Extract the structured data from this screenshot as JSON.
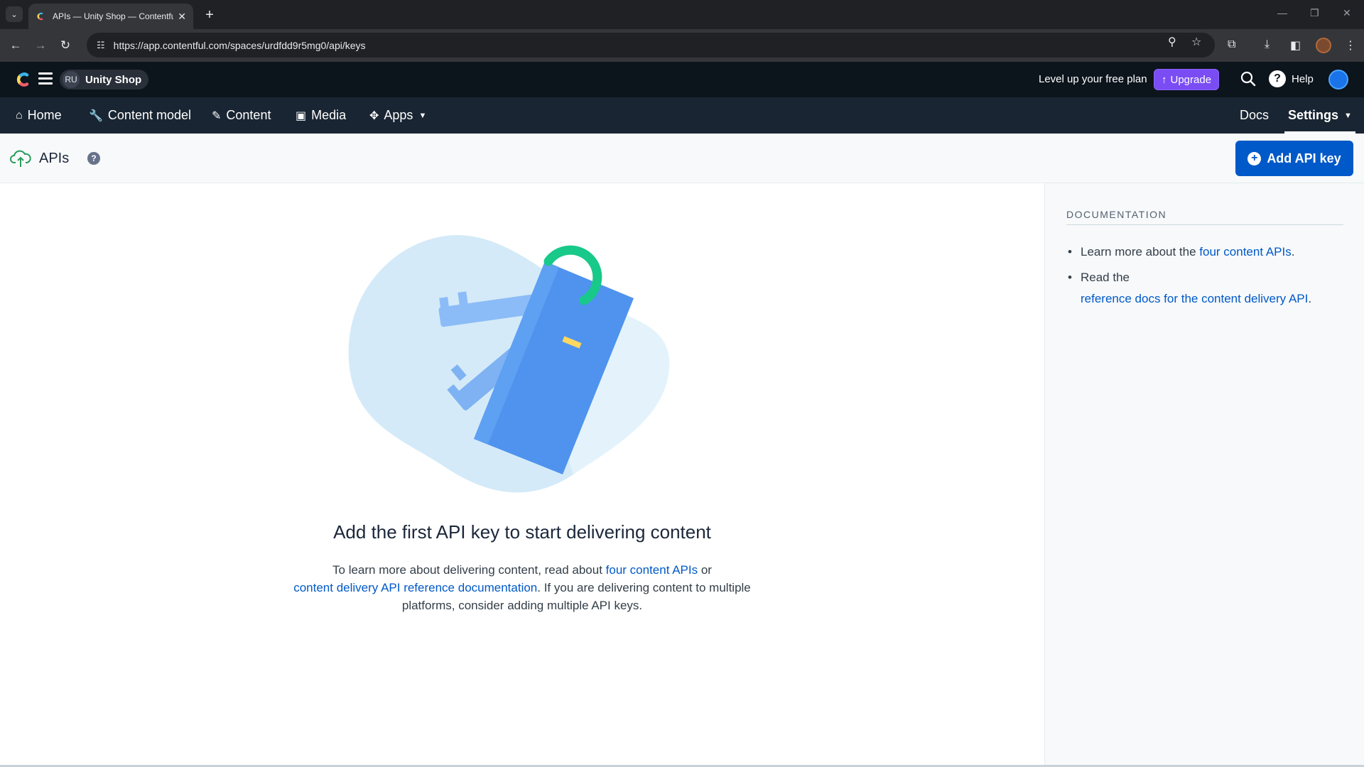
{
  "browser": {
    "tab_title": "APIs — Unity Shop — Contentful",
    "tab_close": "✕",
    "new_tab": "+",
    "url": "https://app.contentful.com/spaces/urdfdd9r5mg0/api/keys"
  },
  "app": {
    "space_initials": "RU",
    "space_name": "Unity Shop",
    "level_up": "Level up your free plan",
    "upgrade_label": "Upgrade",
    "help_label": "Help",
    "brand_color": "#0059c8",
    "upgrade_color": "#7a4cf4"
  },
  "nav": {
    "home": "Home",
    "content_model": "Content model",
    "content": "Content",
    "media": "Media",
    "apps": "Apps",
    "docs": "Docs",
    "settings": "Settings"
  },
  "page": {
    "title": "APIs",
    "add_button": "Add API key"
  },
  "empty_state": {
    "title": "Add the first API key to start delivering content",
    "desc_1": "To learn more about delivering content, read about ",
    "link_1": "four content APIs",
    "desc_2": " or ",
    "link_2": "content delivery API reference documentation",
    "desc_3": ". If you are delivering content to multiple platforms, consider adding multiple API keys."
  },
  "documentation": {
    "heading": "DOCUMENTATION",
    "item1_text": "Learn more about the ",
    "item1_link": "four content APIs",
    "item1_end": ".",
    "item2_text": "Read the",
    "item2_link": "reference docs for the content delivery API",
    "item2_end": "."
  }
}
